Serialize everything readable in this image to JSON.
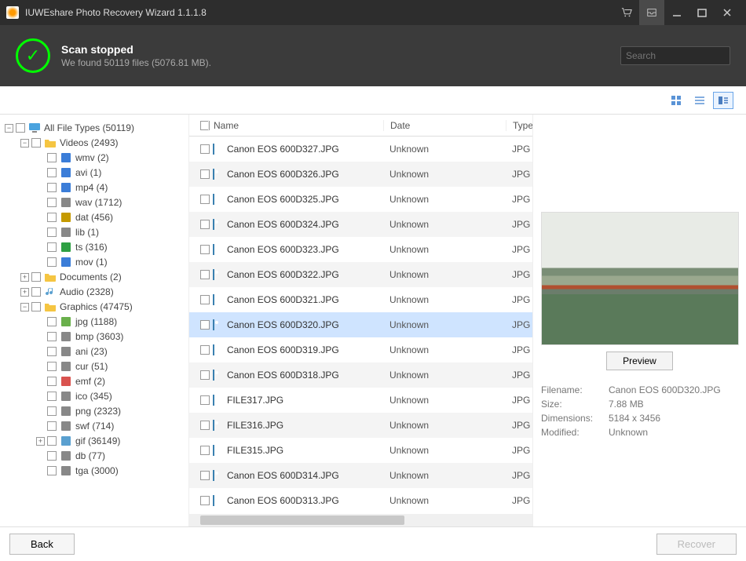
{
  "title": "IUWEshare Photo Recovery Wizard 1.1.1.8",
  "header": {
    "title": "Scan stopped",
    "subtitle": "We found 50119 files (5076.81 MB)."
  },
  "search": {
    "placeholder": "Search"
  },
  "tree": [
    {
      "d": 0,
      "tog": "-",
      "icon": "pc",
      "label": "All File Types (50119)"
    },
    {
      "d": 1,
      "tog": "-",
      "icon": "fld",
      "label": "Videos (2493)"
    },
    {
      "d": 2,
      "tog": "",
      "icon": "wmv",
      "label": "wmv (2)"
    },
    {
      "d": 2,
      "tog": "",
      "icon": "avi",
      "label": "avi (1)"
    },
    {
      "d": 2,
      "tog": "",
      "icon": "mp4",
      "label": "mp4 (4)"
    },
    {
      "d": 2,
      "tog": "",
      "icon": "wav",
      "label": "wav (1712)"
    },
    {
      "d": 2,
      "tog": "",
      "icon": "dat",
      "label": "dat (456)"
    },
    {
      "d": 2,
      "tog": "",
      "icon": "lib",
      "label": "lib (1)"
    },
    {
      "d": 2,
      "tog": "",
      "icon": "ts",
      "label": "ts (316)"
    },
    {
      "d": 2,
      "tog": "",
      "icon": "mov",
      "label": "mov (1)"
    },
    {
      "d": 1,
      "tog": "+",
      "icon": "fld",
      "label": "Documents (2)"
    },
    {
      "d": 1,
      "tog": "+",
      "icon": "aud",
      "label": "Audio (2328)"
    },
    {
      "d": 1,
      "tog": "-",
      "icon": "fld",
      "label": "Graphics (47475)"
    },
    {
      "d": 2,
      "tog": "",
      "icon": "img",
      "label": "jpg (1188)"
    },
    {
      "d": 2,
      "tog": "",
      "icon": "bmp",
      "label": "bmp (3603)"
    },
    {
      "d": 2,
      "tog": "",
      "icon": "ani",
      "label": "ani (23)"
    },
    {
      "d": 2,
      "tog": "",
      "icon": "cur",
      "label": "cur (51)"
    },
    {
      "d": 2,
      "tog": "",
      "icon": "emf",
      "label": "emf (2)"
    },
    {
      "d": 2,
      "tog": "",
      "icon": "ico",
      "label": "ico (345)"
    },
    {
      "d": 2,
      "tog": "",
      "icon": "png",
      "label": "png (2323)"
    },
    {
      "d": 2,
      "tog": "",
      "icon": "swf",
      "label": "swf (714)"
    },
    {
      "d": 2,
      "tog": "+",
      "icon": "gif",
      "label": "gif (36149)"
    },
    {
      "d": 2,
      "tog": "",
      "icon": "db",
      "label": "db (77)"
    },
    {
      "d": 2,
      "tog": "",
      "icon": "tga",
      "label": "tga (3000)"
    }
  ],
  "columns": {
    "name": "Name",
    "date": "Date",
    "type": "Type"
  },
  "files": [
    {
      "name": "Canon EOS 600D327.JPG",
      "date": "Unknown",
      "type": "JPG",
      "sel": false
    },
    {
      "name": "Canon EOS 600D326.JPG",
      "date": "Unknown",
      "type": "JPG",
      "sel": false
    },
    {
      "name": "Canon EOS 600D325.JPG",
      "date": "Unknown",
      "type": "JPG",
      "sel": false
    },
    {
      "name": "Canon EOS 600D324.JPG",
      "date": "Unknown",
      "type": "JPG",
      "sel": false
    },
    {
      "name": "Canon EOS 600D323.JPG",
      "date": "Unknown",
      "type": "JPG",
      "sel": false
    },
    {
      "name": "Canon EOS 600D322.JPG",
      "date": "Unknown",
      "type": "JPG",
      "sel": false
    },
    {
      "name": "Canon EOS 600D321.JPG",
      "date": "Unknown",
      "type": "JPG",
      "sel": false
    },
    {
      "name": "Canon EOS 600D320.JPG",
      "date": "Unknown",
      "type": "JPG",
      "sel": true
    },
    {
      "name": "Canon EOS 600D319.JPG",
      "date": "Unknown",
      "type": "JPG",
      "sel": false
    },
    {
      "name": "Canon EOS 600D318.JPG",
      "date": "Unknown",
      "type": "JPG",
      "sel": false
    },
    {
      "name": "FILE317.JPG",
      "date": "Unknown",
      "type": "JPG",
      "sel": false
    },
    {
      "name": "FILE316.JPG",
      "date": "Unknown",
      "type": "JPG",
      "sel": false
    },
    {
      "name": "FILE315.JPG",
      "date": "Unknown",
      "type": "JPG",
      "sel": false
    },
    {
      "name": "Canon EOS 600D314.JPG",
      "date": "Unknown",
      "type": "JPG",
      "sel": false
    },
    {
      "name": "Canon EOS 600D313.JPG",
      "date": "Unknown",
      "type": "JPG",
      "sel": false
    }
  ],
  "preview": {
    "button": "Preview",
    "meta": {
      "filename_k": "Filename:",
      "filename_v": "Canon EOS 600D320.JPG",
      "size_k": "Size:",
      "size_v": "7.88 MB",
      "dim_k": "Dimensions:",
      "dim_v": "5184 x 3456",
      "mod_k": "Modified:",
      "mod_v": "Unknown"
    }
  },
  "footer": {
    "back": "Back",
    "recover": "Recover"
  }
}
